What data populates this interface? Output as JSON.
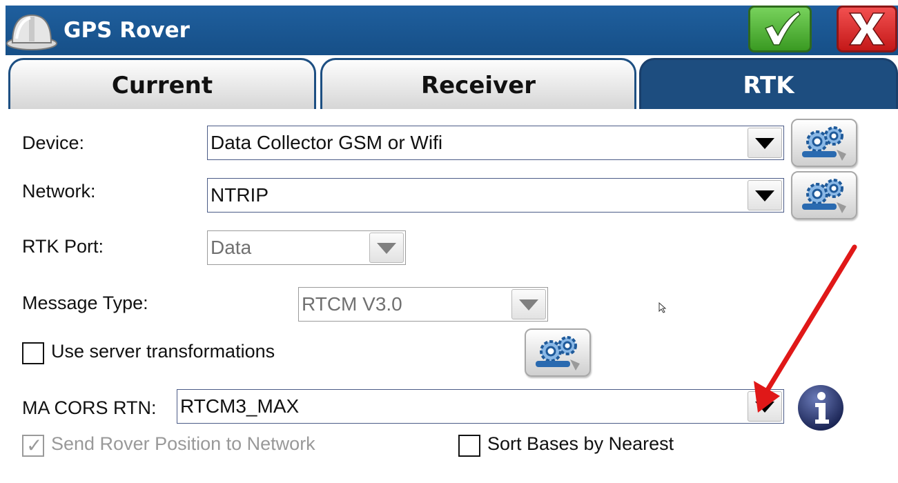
{
  "window": {
    "title": "GPS Rover"
  },
  "tabs": [
    {
      "label": "Current",
      "active": false
    },
    {
      "label": "Receiver",
      "active": false
    },
    {
      "label": "RTK",
      "active": true
    }
  ],
  "form": {
    "device": {
      "label": "Device:",
      "value": "Data Collector GSM or Wifi"
    },
    "network": {
      "label": "Network:",
      "value": "NTRIP"
    },
    "rtk_port": {
      "label": "RTK Port:",
      "value": "Data",
      "disabled": true
    },
    "message_type": {
      "label": "Message Type:",
      "value": "RTCM V3.0",
      "disabled": true
    },
    "use_server_transformations": {
      "label": "Use server transformations",
      "checked": false
    },
    "ma_cors_rtn": {
      "label": "MA CORS RTN:",
      "value": "RTCM3_MAX"
    },
    "send_rover_position": {
      "label": "Send Rover Position to Network",
      "checked": true,
      "disabled": true
    },
    "sort_bases_by_nearest": {
      "label": "Sort Bases by Nearest",
      "checked": false
    }
  },
  "icons": {
    "app": "hardhat-icon",
    "ok": "checkmark-icon",
    "close": "close-x-icon",
    "settings": "gears-wrench-icon",
    "info": "info-icon"
  },
  "colors": {
    "titlebar": "#1f5f9e",
    "active_tab": "#1d4d7f",
    "ok_green": "#3a9a22",
    "close_red": "#c41818",
    "annotation_arrow": "#e01818"
  }
}
